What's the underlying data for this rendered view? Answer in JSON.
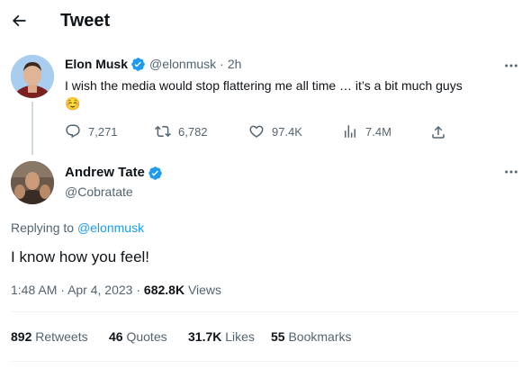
{
  "header": {
    "title": "Tweet",
    "back_icon": "arrow-left-icon"
  },
  "parent_tweet": {
    "author_name": "Elon Musk",
    "handle": "@elonmusk",
    "separator": "·",
    "time": "2h",
    "text": "I wish the media would stop flattering me all time … it’s a bit much guys",
    "emoji": "☺️",
    "replies": "7,271",
    "retweets": "6,782",
    "likes": "97.4K",
    "views": "7.4M"
  },
  "main_tweet": {
    "author_name": "Andrew Tate",
    "handle": "@Cobratate",
    "replying_to_label": "Replying to",
    "replying_to_handle": "@elonmusk",
    "text": "I know how you feel!",
    "time": "1:48 AM",
    "date_sep": "·",
    "date": "Apr 4, 2023",
    "views_sep": "·",
    "views_count": "682.8K",
    "views_label": "Views"
  },
  "stats": {
    "retweets_count": "892",
    "retweets_label": "Retweets",
    "quotes_count": "46",
    "quotes_label": "Quotes",
    "likes_count": "31.7K",
    "likes_label": "Likes",
    "bookmarks_count": "55",
    "bookmarks_label": "Bookmarks"
  },
  "colors": {
    "accent": "#1d9bf0",
    "text": "#0f1419",
    "secondary": "#536471",
    "divider": "#eff3f4",
    "thread_line": "#cfd9de"
  }
}
